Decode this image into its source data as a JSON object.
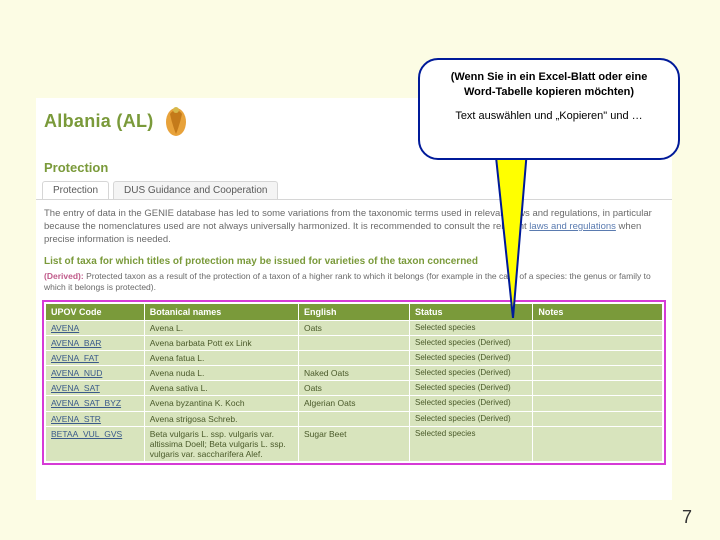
{
  "callout": {
    "line1": "(Wenn Sie in ein Excel-Blatt oder eine",
    "line2": "Word-Tabelle kopieren möchten)",
    "sub": "Text auswählen und „Kopieren\" und …"
  },
  "country_title": "Albania (AL)",
  "section_title": "Protection",
  "tabs": {
    "t1": "Protection",
    "t2": "DUS Guidance and Cooperation"
  },
  "intro": {
    "p1a": "The entry of data in the GENIE database has led to some variations from the taxonomic terms used in relevant laws and regulations, in particular because the nomenclatures used are not always universally harmonized. It is recommended to consult the relevant ",
    "link": "laws and regulations",
    "p1b": " when precise information is needed."
  },
  "list_heading": "List of taxa for which titles of protection may be issued for varieties of the taxon concerned",
  "derived": {
    "label": "(Derived):",
    "text": " Protected taxon as a result of the protection of a taxon of a higher rank to which it belongs (for example in the case of a species: the genus or family to which it belongs is protected)."
  },
  "headers": {
    "h1": "UPOV Code",
    "h2": "Botanical names",
    "h3": "English",
    "h4": "Status",
    "h5": "Notes"
  },
  "rows": [
    {
      "code": "AVENA",
      "bot": "Avena L.",
      "en": "Oats",
      "status": "Selected species",
      "notes": ""
    },
    {
      "code": "AVENA_BAR",
      "bot": "Avena barbata Pott ex Link",
      "en": "",
      "status": "Selected species (Derived)",
      "notes": ""
    },
    {
      "code": "AVENA_FAT",
      "bot": "Avena fatua L.",
      "en": "",
      "status": "Selected species (Derived)",
      "notes": ""
    },
    {
      "code": "AVENA_NUD",
      "bot": "Avena nuda L.",
      "en": "Naked Oats",
      "status": "Selected species (Derived)",
      "notes": ""
    },
    {
      "code": "AVENA_SAT",
      "bot": "Avena sativa L.",
      "en": "Oats",
      "status": "Selected species (Derived)",
      "notes": ""
    },
    {
      "code": "AVENA_SAT_BYZ",
      "bot": "Avena byzantina K. Koch",
      "en": "Algerian Oats",
      "status": "Selected species (Derived)",
      "notes": ""
    },
    {
      "code": "AVENA_STR",
      "bot": "Avena strigosa Schreb.",
      "en": "",
      "status": "Selected species (Derived)",
      "notes": ""
    },
    {
      "code": "BETAA_VUL_GVS",
      "bot": "Beta vulgaris L. ssp. vulgaris var. altissima Doell; Beta vulgaris L. ssp. vulgaris var. saccharifera Alef.",
      "en": "Sugar Beet",
      "status": "Selected species",
      "notes": ""
    }
  ],
  "page_number": "7"
}
